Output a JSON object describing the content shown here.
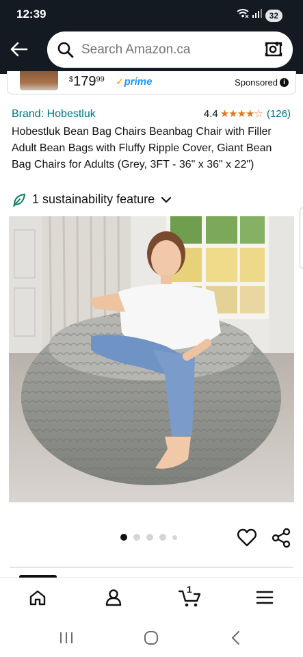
{
  "status_bar": {
    "time": "12:39",
    "battery": "32",
    "icons": [
      "wifi-icon",
      "signal-icon",
      "battery-icon"
    ]
  },
  "header": {
    "back_icon": "back-arrow-icon",
    "search": {
      "placeholder": "Search Amazon.ca",
      "search_icon": "search-icon",
      "camera_icon": "camera-search-icon"
    }
  },
  "sponsored_ad": {
    "price_symbol": "$",
    "price_whole": "179",
    "price_fraction": "99",
    "prime_label": "prime",
    "sponsored_label": "Sponsored"
  },
  "product": {
    "brand": "Brand: Hobestluk",
    "rating": "4.4",
    "stars_glyphs": "★★★★☆",
    "review_count": "(126)",
    "title": "Hobestluk Bean Bag Chairs Beanbag Chair with Filler Adult Bean Bags with Fluffy Ripple Cover, Giant Bean Bag Chairs for Adults (Grey, 3FT - 36\" x 36\" x 22\")",
    "sustainability": "1 sustainability feature",
    "image_description_icon": "product-photo"
  },
  "carousel": {
    "dot_count": 5,
    "active_index": 0
  },
  "bottom_nav": {
    "items": [
      "home-icon",
      "account-icon",
      "cart-icon",
      "menu-icon"
    ],
    "cart_count": "1"
  },
  "system_nav": {
    "items": [
      "recent-apps-icon",
      "home-circle-icon",
      "back-chevron-icon"
    ]
  },
  "colors": {
    "header_bg": "#131a22",
    "link": "#007185",
    "star": "#de7921",
    "prime_blue": "#1a98ff",
    "leaf_green": "#067d62"
  }
}
